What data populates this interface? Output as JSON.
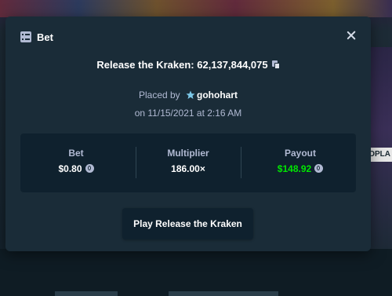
{
  "modal": {
    "title": "Bet",
    "bet_name": "Release the Kraken: 62,137,844,075",
    "placed_by_prefix": "Placed by",
    "username": "gohohart",
    "date": "on 11/15/2021 at 2:16 AM",
    "stats": {
      "bet_label": "Bet",
      "bet_value": "$0.80",
      "multiplier_label": "Multiplier",
      "multiplier_value": "186.00×",
      "payout_label": "Payout",
      "payout_value": "$148.92"
    },
    "play_button_label": "Play Release the Kraken"
  },
  "background": {
    "right_label": "OPLA"
  },
  "colors": {
    "modal_bg": "#1a2c38",
    "panel_bg": "#0f212e",
    "muted_text": "#b1bad3",
    "payout_green": "#00e701"
  }
}
